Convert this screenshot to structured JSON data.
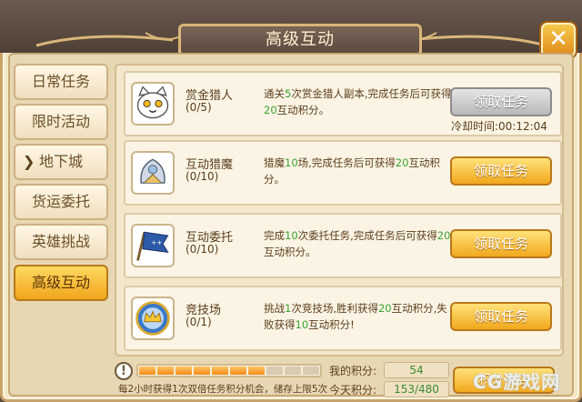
{
  "window": {
    "title": "高级互动",
    "close_glyph": "✕"
  },
  "nav": {
    "items": [
      {
        "label": "日常任务",
        "active": false,
        "arrow": ""
      },
      {
        "label": "限时活动",
        "active": false,
        "arrow": ""
      },
      {
        "label": "地下城",
        "active": false,
        "arrow": "❯"
      },
      {
        "label": "货运委托",
        "active": false,
        "arrow": ""
      },
      {
        "label": "英雄挑战",
        "active": false,
        "arrow": ""
      },
      {
        "label": "高级互动",
        "active": true,
        "arrow": ""
      }
    ]
  },
  "tasks": [
    {
      "name": "赏金猎人",
      "progress": "(0/5)",
      "desc_parts": [
        "通关",
        "5",
        "次赏金猎人副本,完成任务后可获得",
        "20",
        "互动积分。"
      ],
      "button": "领取任务",
      "button_state": "disabled",
      "cooldown": "冷却时间:00:12:04",
      "icon": "cat-face-icon"
    },
    {
      "name": "互动猎魔",
      "progress": "(0/10)",
      "desc_parts": [
        "猎魔",
        "10",
        "场,完成任务后可获得",
        "20",
        "互动积分。"
      ],
      "button": "领取任务",
      "button_state": "enabled",
      "cooldown": "",
      "icon": "armor-helmet-icon"
    },
    {
      "name": "互动委托",
      "progress": "(0/10)",
      "desc_parts": [
        "完成",
        "10",
        "次委托任务,完成任务后可获得",
        "20",
        "互动积分。"
      ],
      "button": "领取任务",
      "button_state": "enabled",
      "cooldown": "",
      "icon": "flag-banner-icon"
    },
    {
      "name": "竞技场",
      "progress": "(0/1)",
      "desc_parts": [
        "挑战",
        "1",
        "次竞技场,胜利获得",
        "20",
        "互动积分,失败获得",
        "10",
        "互动积分!"
      ],
      "button": "领取任务",
      "button_state": "enabled",
      "cooldown": "",
      "icon": "crown-medal-icon"
    }
  ],
  "bottom": {
    "alert_glyph": "!",
    "bonus_progress": {
      "filled": 7,
      "total": 10
    },
    "bonus_note": "每2小时获得1次双倍任务积分机会，储存上限5次",
    "my_score_label": "我的积分:",
    "my_score_value": "54",
    "today_score_label": "今天积分:",
    "today_score_value": "153/480",
    "shop_button": "积分商店",
    "watermark": "CG游戏网"
  },
  "colors": {
    "accent_gold": "#f2a81d",
    "highlight_green": "#3aa232",
    "brown_text": "#5a3d1c"
  }
}
